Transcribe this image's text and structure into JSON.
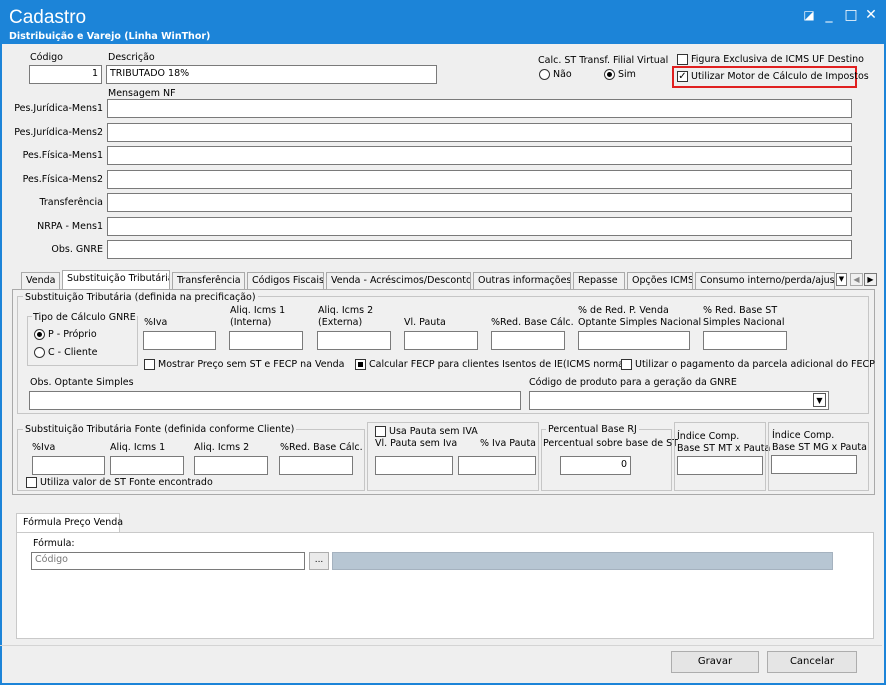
{
  "window": {
    "title": "Cadastro",
    "subtitle": "Distribuição e Varejo (Linha WinThor)",
    "controls": {
      "restore": "◪",
      "minimize": "_",
      "maximize": "□",
      "close": "✕"
    }
  },
  "header": {
    "codigo_label": "Código",
    "codigo_value": "1",
    "descricao_label": "Descrição",
    "descricao_value": "TRIBUTADO 18%",
    "calc_st_label": "Calc. ST Transf. Filial Virtual",
    "nao_label": "Não",
    "sim_label": "Sim",
    "figura_label": "Figura Exclusiva de ICMS UF Destino",
    "motor_label": "Utilizar Motor de Cálculo de Impostos",
    "mensagem_label": "Mensagem NF",
    "highlight_color": "#e02020"
  },
  "message_fields": [
    {
      "label": "Pes.Jurídica-Mens1",
      "value": ""
    },
    {
      "label": "Pes.Jurídica-Mens2",
      "value": ""
    },
    {
      "label": "Pes.Física-Mens1",
      "value": ""
    },
    {
      "label": "Pes.Física-Mens2",
      "value": ""
    },
    {
      "label": "Transferência",
      "value": ""
    },
    {
      "label": "NRPA - Mens1",
      "value": ""
    },
    {
      "label": "Obs. GNRE",
      "value": ""
    }
  ],
  "tabs": [
    {
      "label": "Venda"
    },
    {
      "label": "Substituição Tributária"
    },
    {
      "label": "Transferência"
    },
    {
      "label": "Códigos Fiscais"
    },
    {
      "label": "Venda - Acréscimos/Descontos"
    },
    {
      "label": "Outras informações"
    },
    {
      "label": "Repasse"
    },
    {
      "label": "Opções ICMS"
    },
    {
      "label": "Consumo interno/perda/ajuste"
    }
  ],
  "st": {
    "section_title": "Substituição Tributária (definida na precificação)",
    "tipo_calc_label": "Tipo de Cálculo GNRE",
    "proprio_label": "P - Próprio",
    "cliente_label": "C - Cliente",
    "iva_label": "%Iva",
    "aliq1_label_1": "Aliq. Icms 1",
    "aliq1_label_2": "(Interna)",
    "aliq2_label_1": "Aliq. Icms 2",
    "aliq2_label_2": "(Externa)",
    "vl_pauta_label": "Vl. Pauta",
    "red_base_label": "%Red. Base Cálc.",
    "red_venda_label_1": "% de Red. P. Venda",
    "red_venda_label_2": "Optante Simples Nacional",
    "red_st_label_1": "% Red. Base ST",
    "red_st_label_2": "Simples Nacional",
    "mostrar_preco_label": "Mostrar Preço sem ST e FECP na Venda",
    "calcular_fecp_label": "Calcular FECP para clientes Isentos de IE(ICMS normal)",
    "utilizar_pagamento_label": "Utilizar o pagamento da parcela adicional do FECP",
    "obs_optante_label": "Obs. Optante Simples",
    "codigo_gnre_label": "Código de produto para a geração da GNRE"
  },
  "st_fonte": {
    "section_title": "Substituição Tributária Fonte (definida conforme Cliente)",
    "iva_label": "%Iva",
    "aliq1_label": "Aliq. Icms 1",
    "aliq2_label": "Aliq. Icms 2",
    "red_base_label": "%Red. Base Cálc.",
    "utiliza_label": "Utiliza valor de ST Fonte encontrado",
    "usa_pauta_label": "Usa Pauta sem IVA",
    "vl_pauta_sem_iva_label": "Vl. Pauta sem Iva",
    "iva_pauta_label": "% Iva Pauta",
    "percentual_rj_title": "Percentual Base RJ",
    "percentual_sobre_label": "Percentual sobre base de ST",
    "percentual_value": "0",
    "indice_mt_label_1": "Índice Comp.",
    "indice_mt_label_2": "Base ST MT x Pauta",
    "indice_mg_label_1": "Índice Comp.",
    "indice_mg_label_2": "Base ST MG x Pauta"
  },
  "formula": {
    "tab_label": "Fórmula Preço Venda",
    "formula_label": "Fórmula:",
    "placeholder": "Código",
    "ellipsis": "..."
  },
  "footer": {
    "gravar_label": "Gravar",
    "cancelar_label": "Cancelar"
  }
}
